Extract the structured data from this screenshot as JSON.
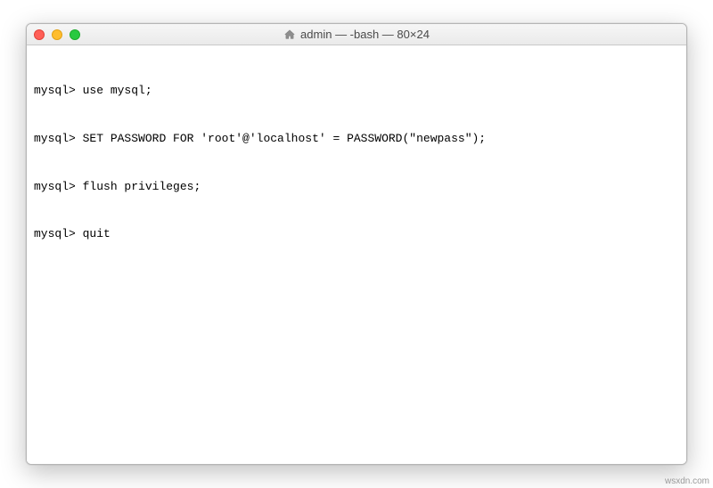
{
  "window": {
    "title": "admin — -bash — 80×24",
    "icon": "home-icon"
  },
  "terminal": {
    "lines": [
      {
        "prompt": "mysql>",
        "command": "use mysql;"
      },
      {
        "prompt": "mysql>",
        "command": "SET PASSWORD FOR 'root'@'localhost' = PASSWORD(\"newpass\");"
      },
      {
        "prompt": "mysql>",
        "command": "flush privileges;"
      },
      {
        "prompt": "mysql>",
        "command": "quit"
      }
    ]
  },
  "attribution": "wsxdn.com"
}
